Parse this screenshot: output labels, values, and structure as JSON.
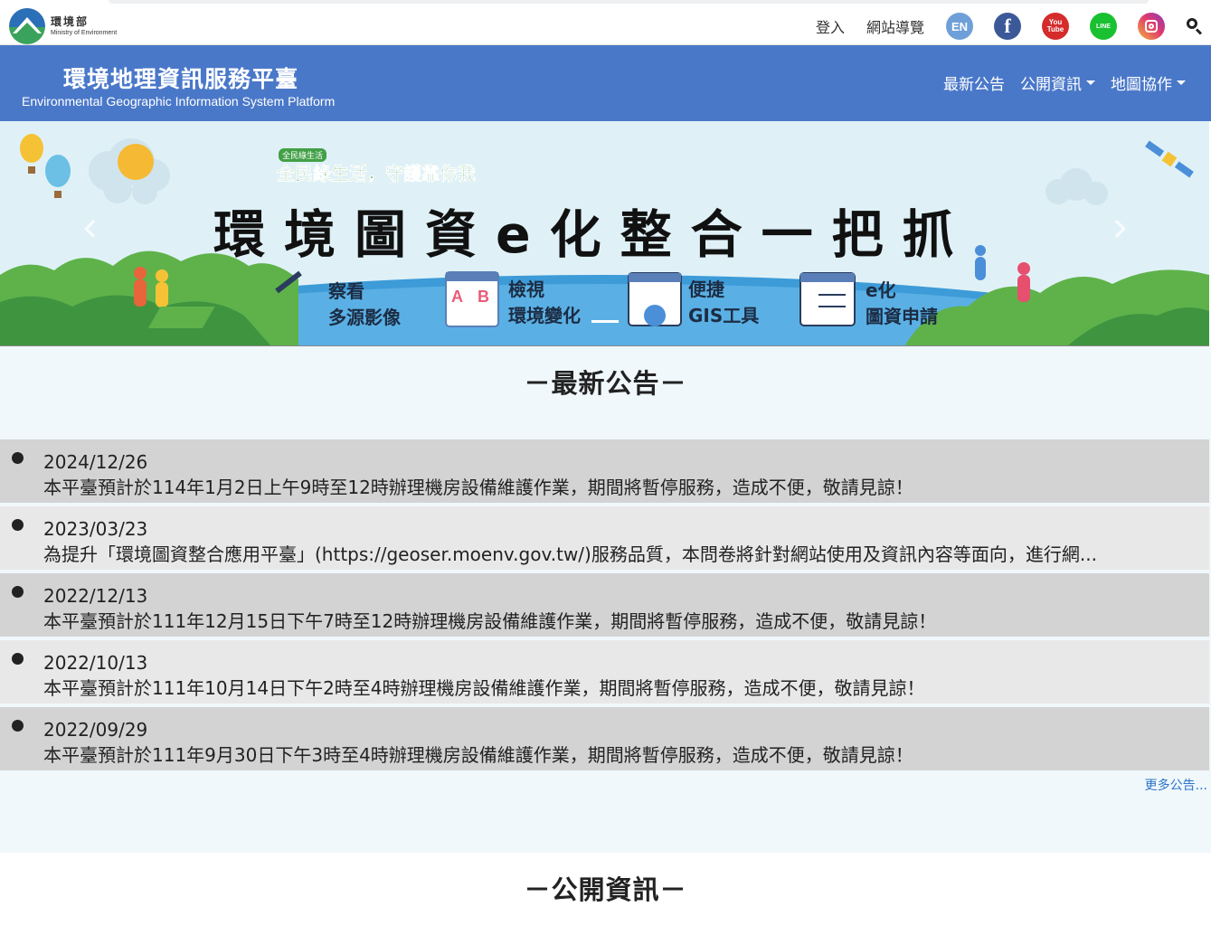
{
  "agency": {
    "name_zh": "環境部",
    "name_en": "Ministry of Environment"
  },
  "utility": {
    "login": "登入",
    "sitemap": "網站導覽",
    "lang_label": "EN",
    "social": [
      "facebook-icon",
      "youtube-icon",
      "line-icon",
      "instagram-icon"
    ],
    "facebook_glyph": "f",
    "youtube_glyph_top": "You",
    "youtube_glyph_bottom": "Tube",
    "line_glyph": "LINE"
  },
  "header": {
    "title": "環境地理資訊服務平臺",
    "subtitle": "Environmental Geographic Information System Platform",
    "nav": [
      {
        "label": "最新公告",
        "dropdown": false
      },
      {
        "label": "公開資訊",
        "dropdown": true
      },
      {
        "label": "地圖協作",
        "dropdown": true
      }
    ]
  },
  "banner": {
    "badge": "全民綠生活",
    "slogan": "全民綠生活，守護靠你我",
    "headline": "環境圖資e化整合一把抓",
    "features": [
      {
        "line1": "察看",
        "line2": "多源影像"
      },
      {
        "line1": "檢視",
        "line2": "環境變化"
      },
      {
        "line1": "便捷",
        "line2": "GIS工具"
      },
      {
        "line1": "e化",
        "line2": "圖資申請"
      }
    ],
    "colors": {
      "sky": "#dff1f7",
      "hill": "#5fb24a",
      "sea": "#3d9bd8",
      "slogan": "#43a047"
    }
  },
  "news": {
    "title": "－最新公告－",
    "items": [
      {
        "date": "2024/12/26",
        "text": "本平臺預計於114年1月2日上午9時至12時辦理機房設備維護作業，期間將暫停服務，造成不便，敬請見諒！"
      },
      {
        "date": "2023/03/23",
        "text": "為提升「環境圖資整合應用平臺」(https://geoser.moenv.gov.tw/)服務品質，本問卷將針對網站使用及資訊內容等面向，進行網..."
      },
      {
        "date": "2022/12/13",
        "text": "本平臺預計於111年12月15日下午7時至12時辦理機房設備維護作業，期間將暫停服務，造成不便，敬請見諒！"
      },
      {
        "date": "2022/10/13",
        "text": "本平臺預計於111年10月14日下午2時至4時辦理機房設備維護作業，期間將暫停服務，造成不便，敬請見諒！"
      },
      {
        "date": "2022/09/29",
        "text": "本平臺預計於111年9月30日下午3時至4時辦理機房設備維護作業，期間將暫停服務，造成不便，敬請見諒！"
      }
    ],
    "more": "更多公告..."
  },
  "public_info": {
    "title": "－公開資訊－"
  },
  "colors": {
    "header_bg": "#4a78c9",
    "news_bg": "#f0f8fc",
    "row_dark": "#d3d3d3",
    "row_light": "#e8e8e8",
    "link": "#2e73c9"
  }
}
